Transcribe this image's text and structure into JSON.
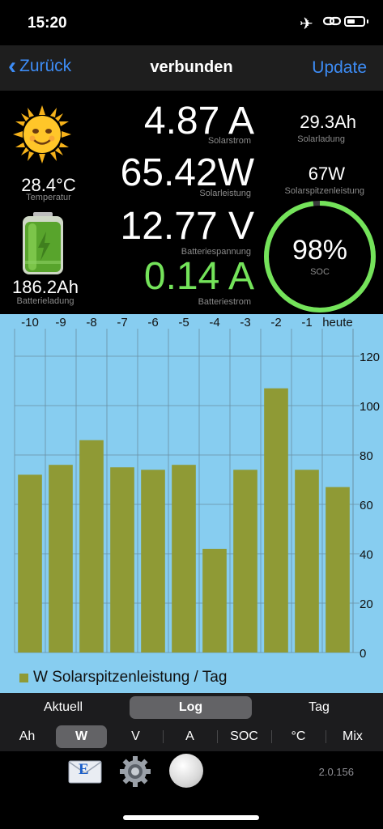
{
  "status": {
    "time": "15:20"
  },
  "nav": {
    "back_label": "Zurück",
    "title": "verbunden",
    "update_label": "Update"
  },
  "dashboard": {
    "temperature": {
      "value": "28.4°C",
      "label": "Temperatur"
    },
    "battery_charge": {
      "value": "186.2Ah",
      "label": "Batterieladung"
    },
    "solar_current": {
      "value": "4.87 A",
      "label": "Solarstrom"
    },
    "solar_power": {
      "value": "65.42W",
      "label": "Solarleistung"
    },
    "battery_voltage": {
      "value": "12.77 V",
      "label": "Batteriespannung"
    },
    "battery_current": {
      "value": "0.14 A",
      "label": "Batteriestrom"
    },
    "solar_charge": {
      "value": "29.3Ah",
      "label": "Solarladung"
    },
    "solar_peak": {
      "value": "67W",
      "label": "Solarspitzenleistung"
    },
    "soc": {
      "value": "98%",
      "label": "SOC",
      "fraction": 0.98
    },
    "colors": {
      "accent_green": "#74e35a",
      "ring_track": "#3a3a3c"
    }
  },
  "chart_data": {
    "type": "bar",
    "categories": [
      "-10",
      "-9",
      "-8",
      "-7",
      "-6",
      "-5",
      "-4",
      "-3",
      "-2",
      "-1",
      "heute"
    ],
    "values": [
      72,
      76,
      86,
      75,
      74,
      76,
      42,
      74,
      107,
      74,
      67
    ],
    "ylim": [
      0,
      120
    ],
    "yticks": [
      "0",
      "20",
      "40",
      "60",
      "80",
      "100",
      "120"
    ],
    "legend": "W Solarspitzenleistung / Tag",
    "bar_color": "#8f9a35",
    "background": "#87cdf0",
    "grid": true
  },
  "tabs": {
    "row1": [
      {
        "label": "Aktuell",
        "selected": false
      },
      {
        "label": "Log",
        "selected": true
      },
      {
        "label": "Tag",
        "selected": false
      }
    ],
    "row2": [
      {
        "label": "Ah",
        "selected": false
      },
      {
        "label": "W",
        "selected": true
      },
      {
        "label": "V",
        "selected": false
      },
      {
        "label": "A",
        "selected": false
      },
      {
        "label": "SOC",
        "selected": false
      },
      {
        "label": "°C",
        "selected": false
      },
      {
        "label": "Mix",
        "selected": false
      }
    ]
  },
  "toolbar": {
    "version": "2.0.156",
    "mail_icon_letter": "E",
    "icons": [
      "mail-icon",
      "gear-icon",
      "record-button"
    ]
  }
}
